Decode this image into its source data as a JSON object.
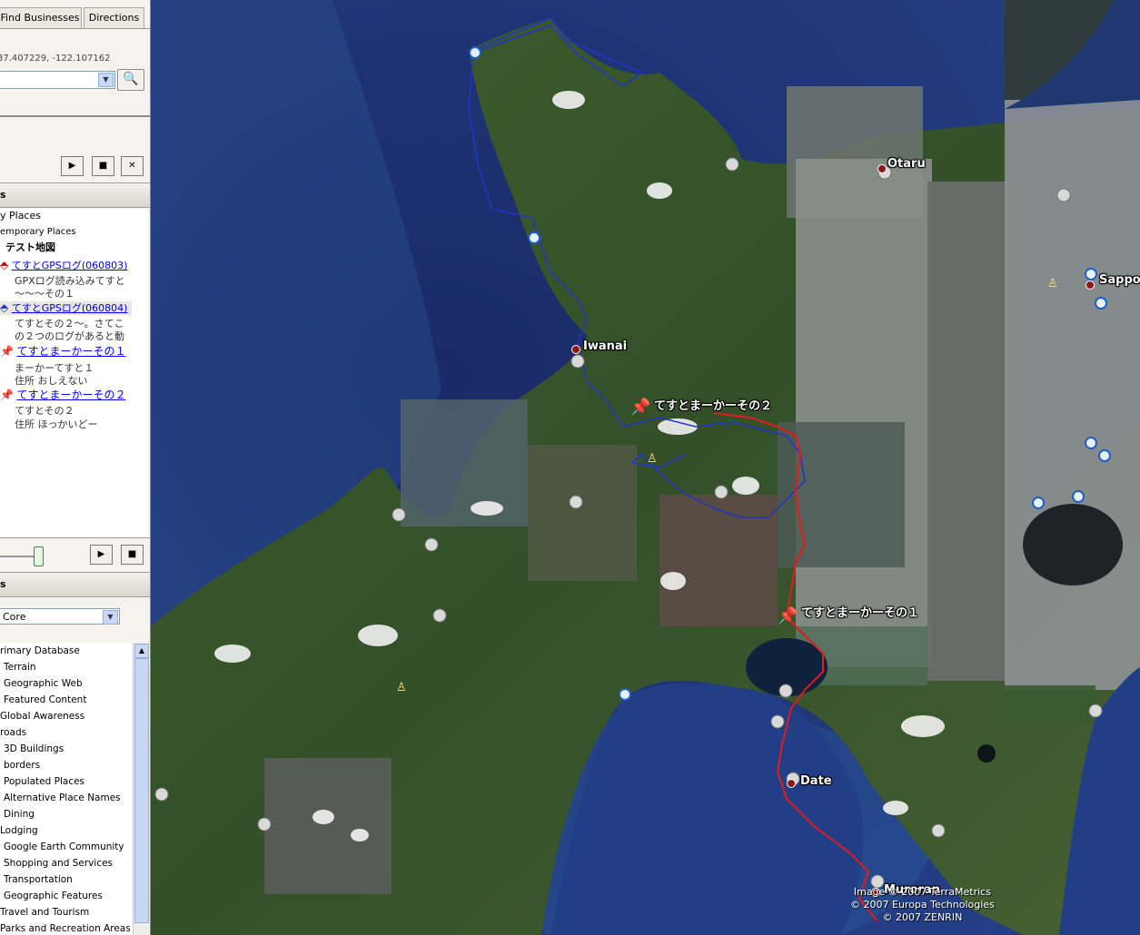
{
  "search": {
    "tabs": [
      "Find Businesses",
      "Directions"
    ],
    "coords": "37.407229, -122.107162",
    "search_icon": "magnifier-icon"
  },
  "tour": {
    "play_icon": "play-icon",
    "stop_icon": "stop-icon",
    "close_icon": "close-icon"
  },
  "places": {
    "header": "s",
    "items": [
      "y Places",
      "emporary Places",
      "テスト地図",
      "てすとGPSログ(060803)",
      "GPXログ読み込みてすと",
      "～～～その１",
      "てすとGPSログ(060804)",
      "てすとその２～。さてこ",
      "の２つのログがあると動",
      "てすとまーかーその１",
      "まーかーてすと１",
      "住所 おしえない",
      "てすとまーかーその２",
      "てすとその２",
      "住所 ほっかいどー"
    ]
  },
  "layers": {
    "header": "s",
    "view": "Core",
    "items": [
      "rimary Database",
      "Terrain",
      "Geographic Web",
      "Featured Content",
      "Global Awareness",
      "roads",
      "3D Buildings",
      "borders",
      "Populated Places",
      "Alternative Place Names",
      "Dining",
      "Lodging",
      "Google Earth Community",
      "Shopping and Services",
      "Transportation",
      "Geographic Features",
      "Travel and Tourism",
      "Parks and Recreation Areas"
    ]
  },
  "map": {
    "labels": {
      "otaru": "Otaru",
      "sapporo": "Sappo",
      "iwanai": "Iwanai",
      "date": "Date",
      "muroran": "Muroran",
      "marker2": "てすとまーかーその２",
      "marker1": "てすとまーかーその１"
    },
    "credits": [
      "Image © 2007 TerraMetrics",
      "© 2007 Europa Technologies",
      "© 2007 ZENRIN"
    ],
    "colors": {
      "route": "#e21b1b",
      "gps_track": "#2233cc",
      "sea": "#1d2f6e",
      "land": "#3f5a2a"
    }
  }
}
